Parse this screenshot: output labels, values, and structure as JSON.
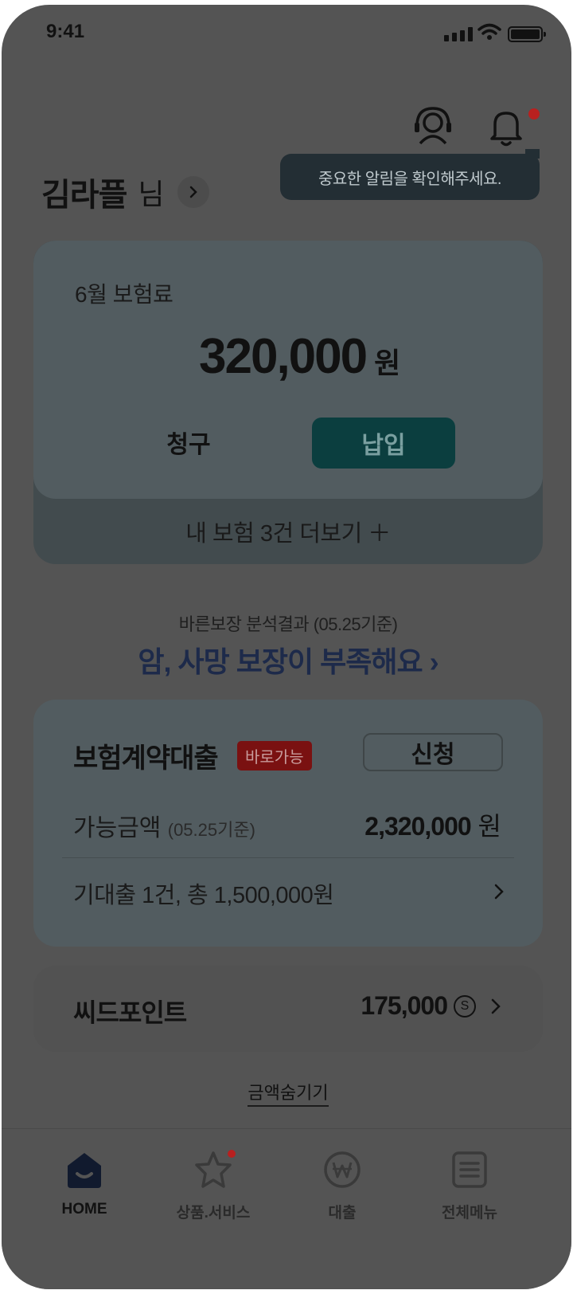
{
  "status": {
    "time": "9:41"
  },
  "tooltip": {
    "text": "중요한 알림을 확인해주세요."
  },
  "user": {
    "name": "김라플",
    "suffix": "님"
  },
  "premium": {
    "label": "6월 보험료",
    "amount": "320,000",
    "unit": "원",
    "claim_label": "청구",
    "pay_label": "납입",
    "more_label": "내 보험 3건 더보기 ＋"
  },
  "analysis": {
    "subtitle": "바른보장 분석결과 (05.25기준)",
    "title": "암, 사망 보장이 부족해요 ›"
  },
  "loan": {
    "title": "보험계약대출",
    "badge": "바로가능",
    "apply_label": "신청",
    "available_label": "가능금액",
    "available_date": "(05.25기준)",
    "available_amount": "2,320,000",
    "available_unit": "원",
    "existing_text": "기대출 1건, 총 1,500,000원"
  },
  "points": {
    "title": "씨드포인트",
    "value": "175,000",
    "symbol": "S"
  },
  "hide_amount_label": "금액숨기기",
  "tabs": [
    {
      "label": "HOME",
      "icon": "home-icon"
    },
    {
      "label": "상품.서비스",
      "icon": "star-icon"
    },
    {
      "label": "대출",
      "icon": "won-coin-icon"
    },
    {
      "label": "전체메뉴",
      "icon": "menu-icon"
    }
  ]
}
